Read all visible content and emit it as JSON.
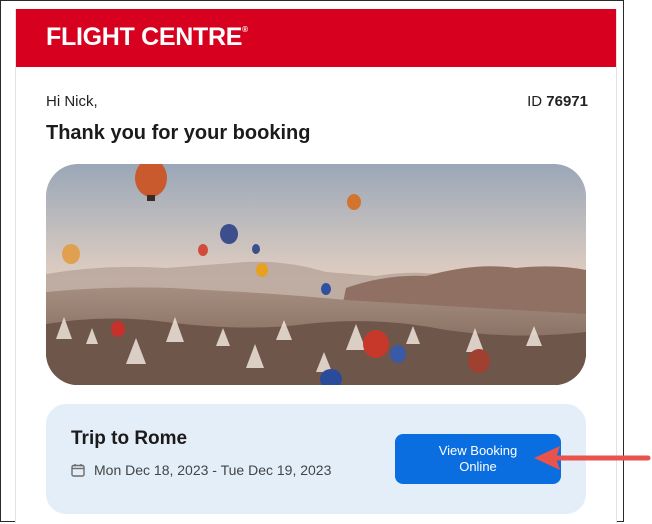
{
  "brand": {
    "name": "FLIGHT CENTRE",
    "mark": "®",
    "color": "#d7001e"
  },
  "greeting": "Hi Nick,",
  "booking": {
    "id_label": "ID",
    "id_value": "76971"
  },
  "headline": "Thank you for your booking",
  "hero": {
    "image": "hot-air-balloons-over-valley"
  },
  "trip": {
    "title": "Trip to Rome",
    "dates": "Mon Dec 18, 2023 - Tue Dec 19, 2023",
    "date_icon": "calendar-icon"
  },
  "cta": {
    "label": "View Booking\nOnline",
    "color": "#0a6ee1"
  },
  "annotation": {
    "icon": "arrow-left-icon",
    "color": "#e8534b"
  }
}
